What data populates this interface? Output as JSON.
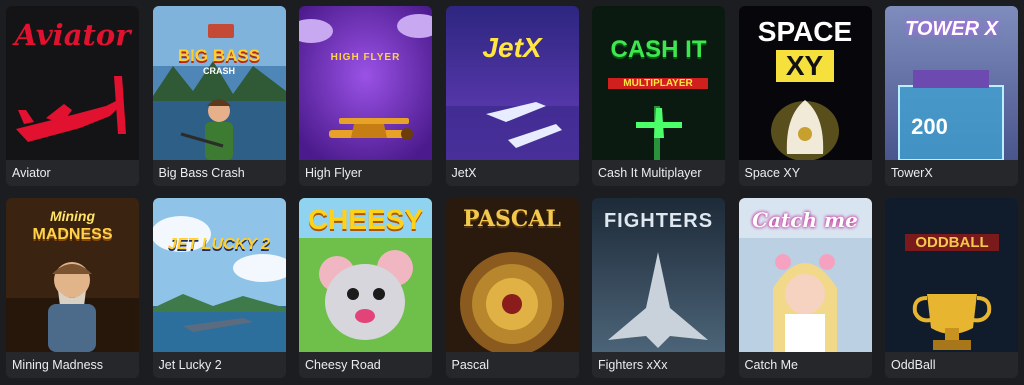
{
  "games": [
    {
      "name": "Aviator",
      "logo": "Aviator"
    },
    {
      "name": "Big Bass Crash",
      "logo": "BIG BASS",
      "logo_sub": "CRASH"
    },
    {
      "name": "High Flyer",
      "logo": "HIGH FLYER"
    },
    {
      "name": "JetX",
      "logo": "JetX"
    },
    {
      "name": "Cash It Multiplayer",
      "logo": "CASH IT",
      "logo_sub": "MULTIPLAYER"
    },
    {
      "name": "Space XY",
      "logo": "SPACE",
      "logo_sub": "XY"
    },
    {
      "name": "TowerX",
      "logo": "TOWER X",
      "tag": "200"
    },
    {
      "name": "Mining Madness",
      "logo": "Mining",
      "logo_sub": "MADNESS"
    },
    {
      "name": "Jet Lucky 2",
      "logo": "JET LUCKY 2"
    },
    {
      "name": "Cheesy Road",
      "logo": "CHEESY"
    },
    {
      "name": "Pascal",
      "logo": "PASCAL"
    },
    {
      "name": "Fighters xXx",
      "logo": "FIGHTERS"
    },
    {
      "name": "Catch Me",
      "logo": "Catch me"
    },
    {
      "name": "OddBall",
      "logo": "ODDBALL"
    }
  ]
}
